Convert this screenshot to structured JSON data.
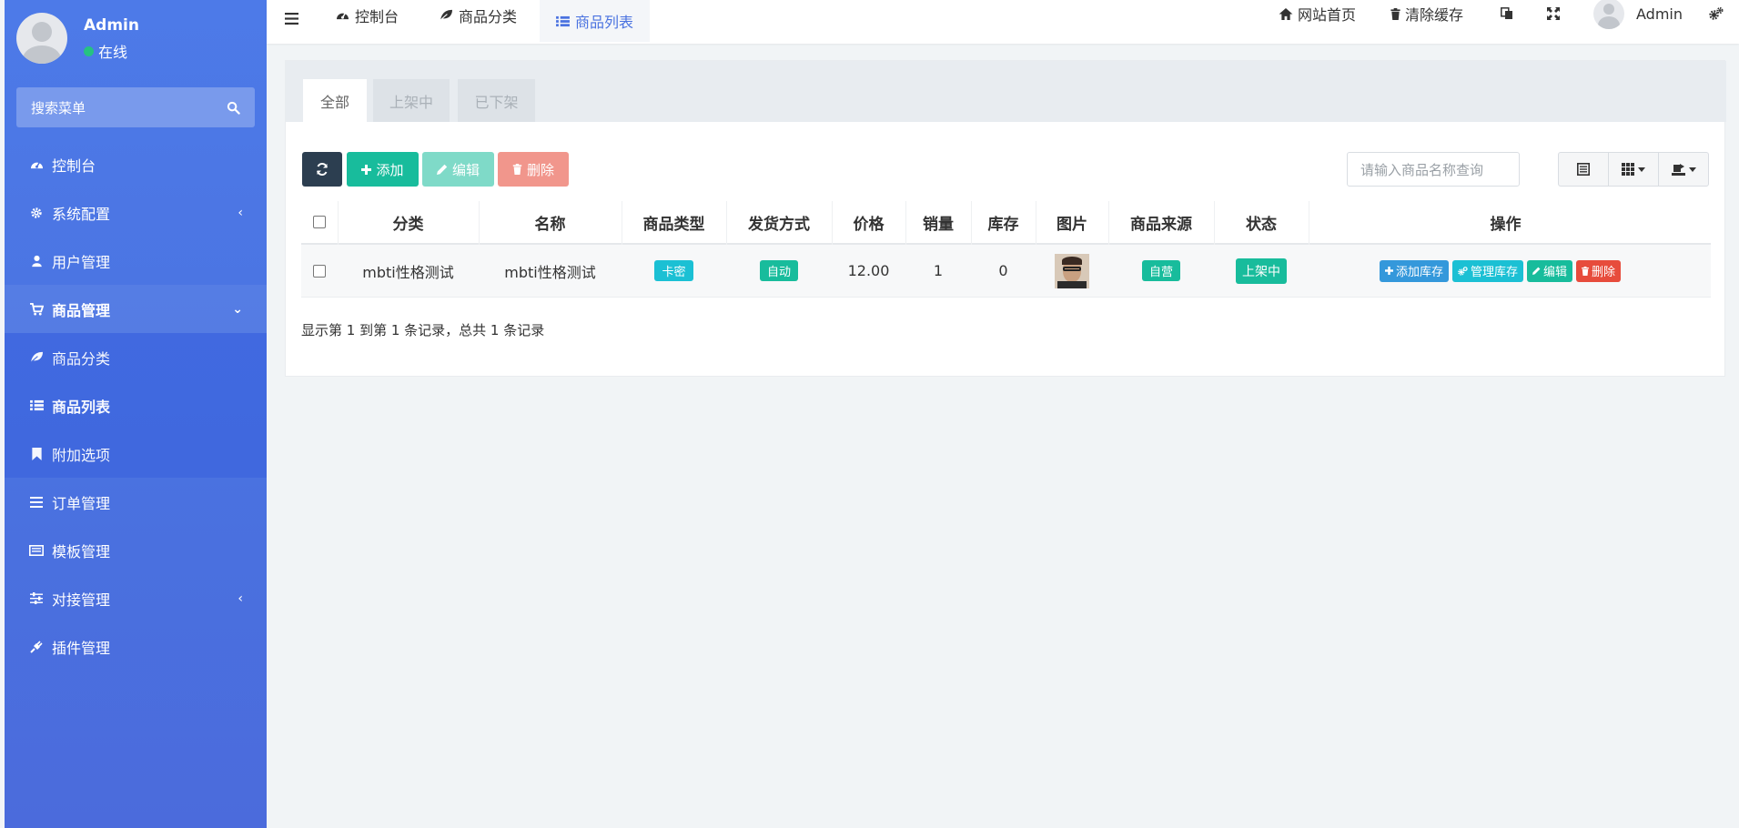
{
  "sidebar": {
    "user": {
      "name": "Admin",
      "status": "在线"
    },
    "search_placeholder": "搜索菜单",
    "items": [
      {
        "label": "控制台",
        "icon": "dashboard-icon"
      },
      {
        "label": "系统配置",
        "icon": "gear-icon",
        "has_children": true
      },
      {
        "label": "用户管理",
        "icon": "user-icon"
      },
      {
        "label": "商品管理",
        "icon": "cart-icon",
        "expanded": true
      },
      {
        "label": "商品分类",
        "icon": "leaf-icon"
      },
      {
        "label": "商品列表",
        "icon": "list-icon",
        "active": true
      },
      {
        "label": "附加选项",
        "icon": "bookmark-icon"
      },
      {
        "label": "订单管理",
        "icon": "bars-icon"
      },
      {
        "label": "模板管理",
        "icon": "template-icon"
      },
      {
        "label": "对接管理",
        "icon": "sliders-icon",
        "has_children": true
      },
      {
        "label": "插件管理",
        "icon": "plug-icon"
      }
    ]
  },
  "topbar": {
    "tabs": [
      {
        "label": "控制台",
        "icon": "dashboard-icon"
      },
      {
        "label": "商品分类",
        "icon": "leaf-icon"
      },
      {
        "label": "商品列表",
        "icon": "list-icon",
        "active": true
      }
    ],
    "right": {
      "home_label": "网站首页",
      "clear_cache_label": "清除缓存",
      "user_name": "Admin"
    }
  },
  "content": {
    "tabs": [
      {
        "label": "全部",
        "active": true
      },
      {
        "label": "上架中"
      },
      {
        "label": "已下架"
      }
    ],
    "toolbar": {
      "add_label": "添加",
      "edit_label": "编辑",
      "delete_label": "删除",
      "search_placeholder": "请输入商品名称查询"
    },
    "table": {
      "headers": [
        "分类",
        "名称",
        "商品类型",
        "发货方式",
        "价格",
        "销量",
        "库存",
        "图片",
        "商品来源",
        "状态",
        "操作"
      ],
      "rows": [
        {
          "category": "mbti性格测试",
          "name": "mbti性格测试",
          "type": "卡密",
          "delivery": "自动",
          "price": "12.00",
          "sales": "1",
          "stock": "0",
          "source": "自营",
          "status": "上架中",
          "actions": [
            "添加库存",
            "管理库存",
            "编辑",
            "删除"
          ]
        }
      ]
    },
    "pagination_text": "显示第 1 到第 1 条记录，总共 1 条记录"
  },
  "colors": {
    "sidebar": "#4a72e0",
    "success": "#18bc9c",
    "info": "#1bc0d4",
    "primary": "#3498db",
    "danger": "#e74c3c",
    "dark": "#2c3e50"
  }
}
